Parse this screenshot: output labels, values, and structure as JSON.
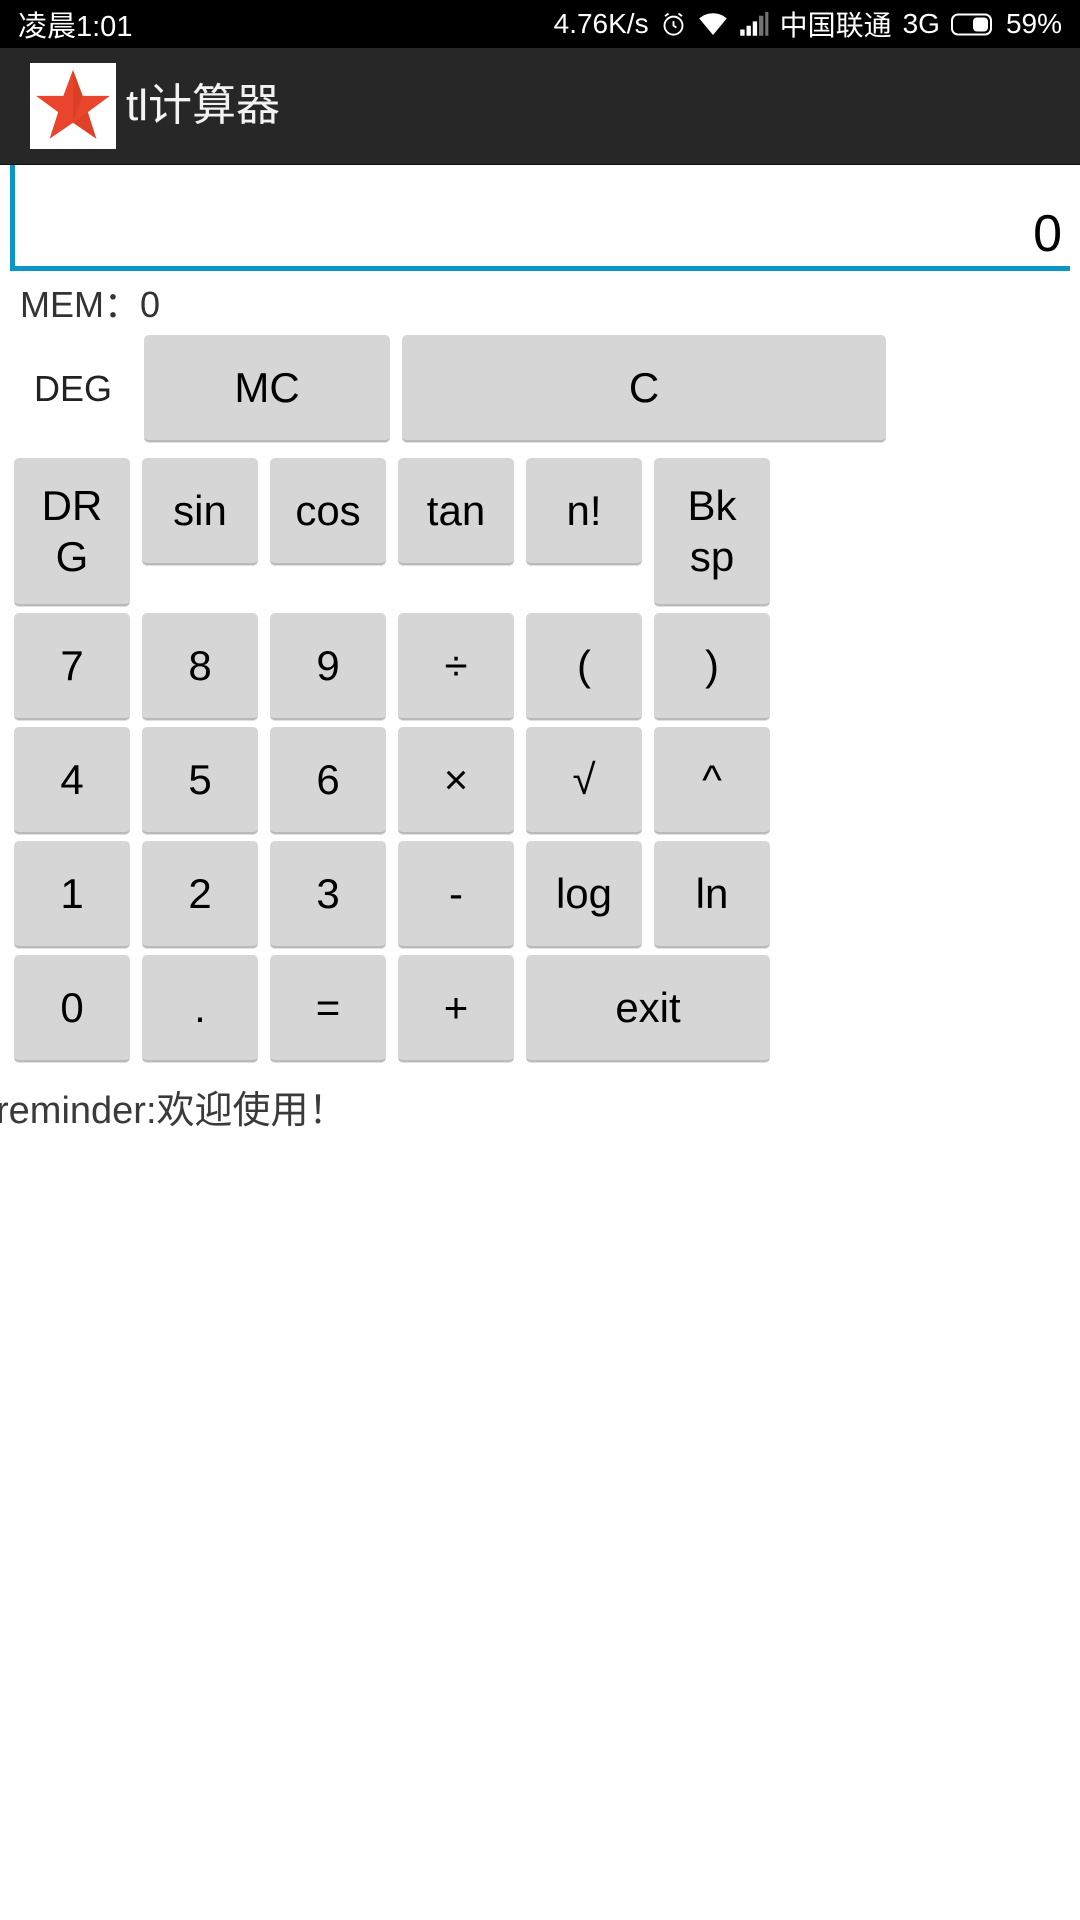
{
  "status_bar": {
    "time": "凌晨1:01",
    "net_speed": "4.76K/s",
    "alarm_icon": "alarm-clock-icon",
    "wifi_icon": "wifi-icon",
    "signal_icon": "signal-bars-icon",
    "carrier": "中国联通",
    "network_type": "3G",
    "battery_icon": "battery-icon",
    "battery_percent": "59%"
  },
  "app_bar": {
    "logo_icon": "red-star-logo-icon",
    "title": "tl计算器",
    "background_color": "#272727",
    "logo_color": "#e8452c"
  },
  "display": {
    "value": "0",
    "underline_color": "#0c95c7"
  },
  "memory": {
    "label": "MEM：0"
  },
  "mode": {
    "label": "DEG"
  },
  "keys": {
    "mc": "MC",
    "clear": "C",
    "drg": "DR\nG",
    "sin": "sin",
    "cos": "cos",
    "tan": "tan",
    "factorial": "n!",
    "backspace": "Bk\nsp",
    "seven": "7",
    "eight": "8",
    "nine": "9",
    "divide": "÷",
    "paren_open": "(",
    "paren_close": ")",
    "four": "4",
    "five": "5",
    "six": "6",
    "multiply": "×",
    "sqrt": "√",
    "power": "^",
    "one": "1",
    "two": "2",
    "three": "3",
    "minus": "-",
    "log": "log",
    "ln": "ln",
    "zero": "0",
    "dot": ".",
    "equals": "=",
    "plus": "+",
    "exit": "exit"
  },
  "footer": {
    "reminder": "reminder:欢迎使用！"
  }
}
